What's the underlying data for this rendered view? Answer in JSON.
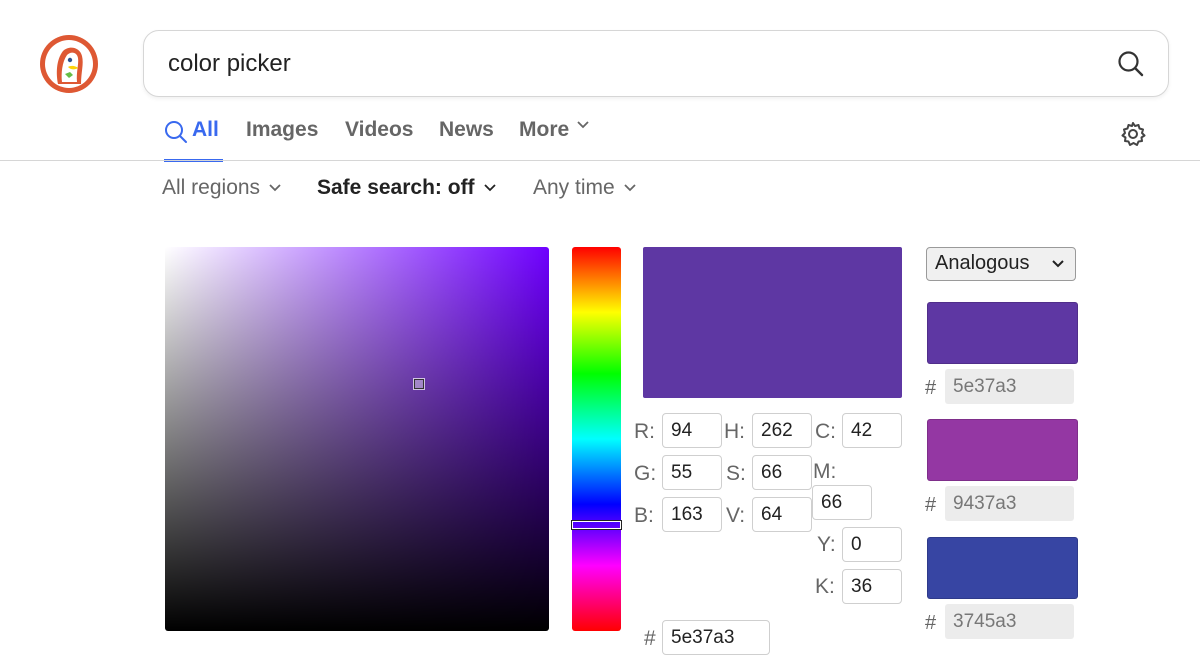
{
  "search": {
    "query": "color picker"
  },
  "tabs": [
    {
      "label": "All",
      "active": true
    },
    {
      "label": "Images",
      "active": false
    },
    {
      "label": "Videos",
      "active": false
    },
    {
      "label": "News",
      "active": false
    },
    {
      "label": "More",
      "active": false
    }
  ],
  "filters": {
    "region": "All regions",
    "safe_search": "Safe search: off",
    "time": "Any time"
  },
  "picker": {
    "selected_color": "#5e37a3",
    "hue_color": "#6f00ff",
    "rgb": {
      "r_label": "R:",
      "r": "94",
      "g_label": "G:",
      "g": "55",
      "b_label": "B:",
      "b": "163"
    },
    "hsv": {
      "h_label": "H:",
      "h": "262",
      "s_label": "S:",
      "s": "66",
      "v_label": "V:",
      "v": "64"
    },
    "cmyk": {
      "c_label": "C:",
      "c": "42",
      "m_label": "M:",
      "m": "66",
      "y_label": "Y:",
      "y": "0",
      "k_label": "K:",
      "k": "36"
    },
    "hex_label": "#",
    "hex": "5e37a3"
  },
  "scheme": {
    "selected": "Analogous",
    "swatches": [
      {
        "color": "#5e37a3",
        "hash": "#",
        "hex": "5e37a3"
      },
      {
        "color": "#9437a3",
        "hash": "#",
        "hex": "9437a3"
      },
      {
        "color": "#3745a3",
        "hash": "#",
        "hex": "3745a3"
      }
    ]
  },
  "icons": {
    "logo": "duckduckgo-logo",
    "search": "search-icon",
    "settings": "gear-icon",
    "chevron": "chevron-down-icon"
  }
}
